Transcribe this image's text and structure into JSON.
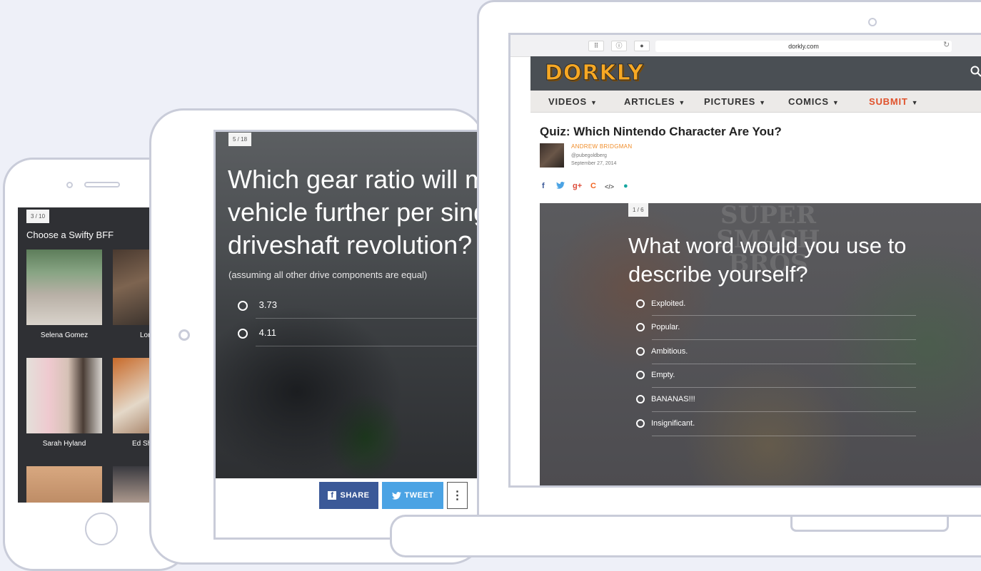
{
  "phone": {
    "counter": "3 / 10",
    "question": "Choose a Swifty BFF",
    "items": [
      {
        "label": "Selena Gomez"
      },
      {
        "label": "Lor"
      },
      {
        "label": "Sarah Hyland"
      },
      {
        "label": "Ed She"
      }
    ]
  },
  "tablet": {
    "counter": "5 / 18",
    "question": "Which gear ratio will move your vehicle further per single driveshaft revolution?",
    "subtitle": "(assuming all other drive components are equal)",
    "options": [
      {
        "label": "3.73"
      },
      {
        "label": "4.11"
      }
    ],
    "share_label": "SHARE",
    "tweet_label": "TWEET",
    "more_label": "⋮"
  },
  "laptop": {
    "browser": {
      "url": "dorkly.com"
    },
    "site": {
      "logo": "DORKLY",
      "nav": [
        {
          "label": "VIDEOS"
        },
        {
          "label": "ARTICLES"
        },
        {
          "label": "PICTURES"
        },
        {
          "label": "COMICS"
        },
        {
          "label": "SUBMIT"
        }
      ]
    },
    "article": {
      "title": "Quiz: Which Nintendo Character Are You?",
      "author": "ANDREW BRIDGMAN",
      "handle": "@pubegoldberg",
      "date": "September 27, 2014"
    },
    "social": {
      "facebook": "f",
      "twitter": "🐦",
      "google": "g+",
      "c": "C",
      "embed": "</>",
      "comment": "●"
    },
    "quiz": {
      "counter": "1 / 6",
      "watermark": "SUPER SMASH BROS",
      "question": "What word would you use to describe yourself?",
      "options": [
        {
          "label": "Exploited."
        },
        {
          "label": "Popular."
        },
        {
          "label": "Ambitious."
        },
        {
          "label": "Empty."
        },
        {
          "label": "BANANAS!!!"
        },
        {
          "label": "Insignificant."
        }
      ]
    }
  },
  "colors": {
    "background": "#eef0f8",
    "device_frame": "#c9ccd9",
    "dorkly_orange": "#f7a823",
    "submit_red": "#e0522c",
    "facebook": "#3b5998",
    "twitter": "#4ba3e4"
  }
}
